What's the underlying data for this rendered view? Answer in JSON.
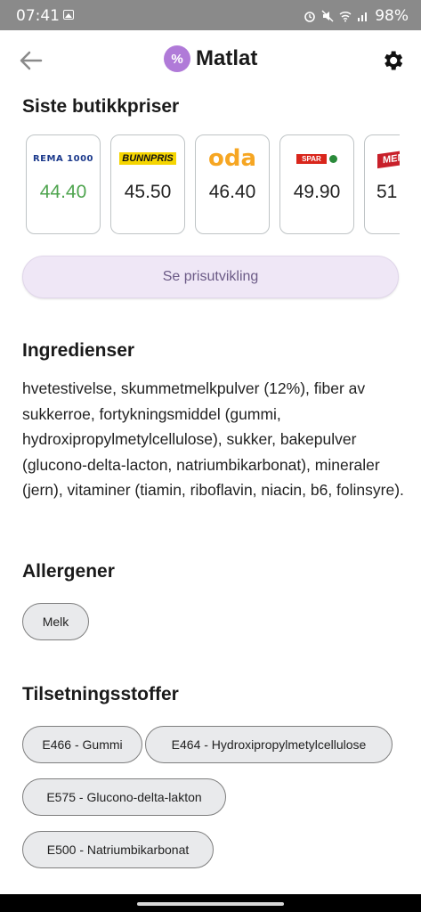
{
  "status_bar": {
    "time": "07:41",
    "battery": "98%",
    "icons": [
      "image-icon",
      "alarm-icon",
      "mute-icon",
      "wifi-icon",
      "signal-icon"
    ]
  },
  "header": {
    "back_icon": "arrow-left-icon",
    "logo_glyph": "%",
    "app_name": "Matlat",
    "settings_icon": "gear-icon"
  },
  "prices": {
    "title": "Siste butikkpriser",
    "stores": [
      {
        "logo": "REMA 1000",
        "price": "44.40",
        "best": true
      },
      {
        "logo": "BUNNPRIS",
        "price": "45.50",
        "best": false
      },
      {
        "logo": "oda",
        "price": "46.40",
        "best": false
      },
      {
        "logo": "SPAR",
        "price": "49.90",
        "best": false
      },
      {
        "logo": "MENY",
        "price": "51",
        "best": false
      }
    ],
    "trend_button": "Se prisutvikling"
  },
  "ingredients": {
    "title": "Ingredienser",
    "text": "hvetestivelse, skummetmelkpulver (12%), fiber av sukkerroe, fortykningsmiddel (gummi, hydroxipropylmetylcellulose), sukker, bakepulver (glucono-delta-lacton, natriumbikarbonat), mineraler (jern), vitaminer (tiamin,  riboflavin, niacin, b6, folinsyre)."
  },
  "allergens": {
    "title": "Allergener",
    "items": [
      "Melk"
    ]
  },
  "additives": {
    "title": "Tilsetningsstoffer",
    "items": [
      "E466 - Gummi",
      "E464 - Hydroxipropylmetylcellulose",
      "E575 - Glucono-delta-lakton",
      "E500 - Natriumbikarbonat"
    ]
  },
  "colors": {
    "best_price": "#4ea44e",
    "brand": "#b07ad8",
    "button_bg": "#efe7f6",
    "chip_bg": "#e9eaec"
  }
}
